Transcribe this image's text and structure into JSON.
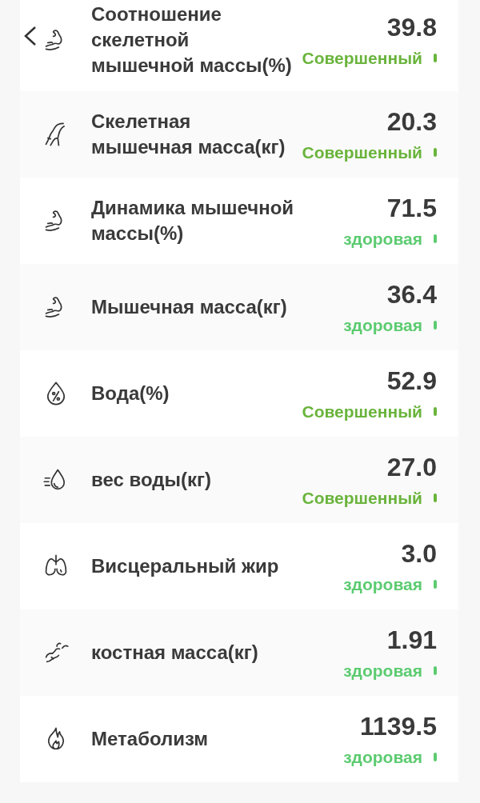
{
  "metrics": [
    {
      "label": "Соотношение скелетной мышечной массы(%)",
      "value": "39.8",
      "status": "Совершенный",
      "color": "#6ab43c"
    },
    {
      "label": "Скелетная мышечная масса(кг)",
      "value": "20.3",
      "status": "Совершенный",
      "color": "#6ab43c"
    },
    {
      "label": "Динамика мышечной массы(%)",
      "value": "71.5",
      "status": "здоровая",
      "color": "#5ccb70"
    },
    {
      "label": "Мышечная масса(кг)",
      "value": "36.4",
      "status": "здоровая",
      "color": "#5ccb70"
    },
    {
      "label": "Вода(%)",
      "value": "52.9",
      "status": "Совершенный",
      "color": "#6ab43c"
    },
    {
      "label": "вес воды(кг)",
      "value": "27.0",
      "status": "Совершенный",
      "color": "#6ab43c"
    },
    {
      "label": "Висцеральный жир",
      "value": "3.0",
      "status": "здоровая",
      "color": "#5ccb70"
    },
    {
      "label": "костная масса(кг)",
      "value": "1.91",
      "status": "здоровая",
      "color": "#5ccb70"
    },
    {
      "label": "Метаболизм",
      "value": "1139.5",
      "status": "здоровая",
      "color": "#5ccb70"
    }
  ]
}
